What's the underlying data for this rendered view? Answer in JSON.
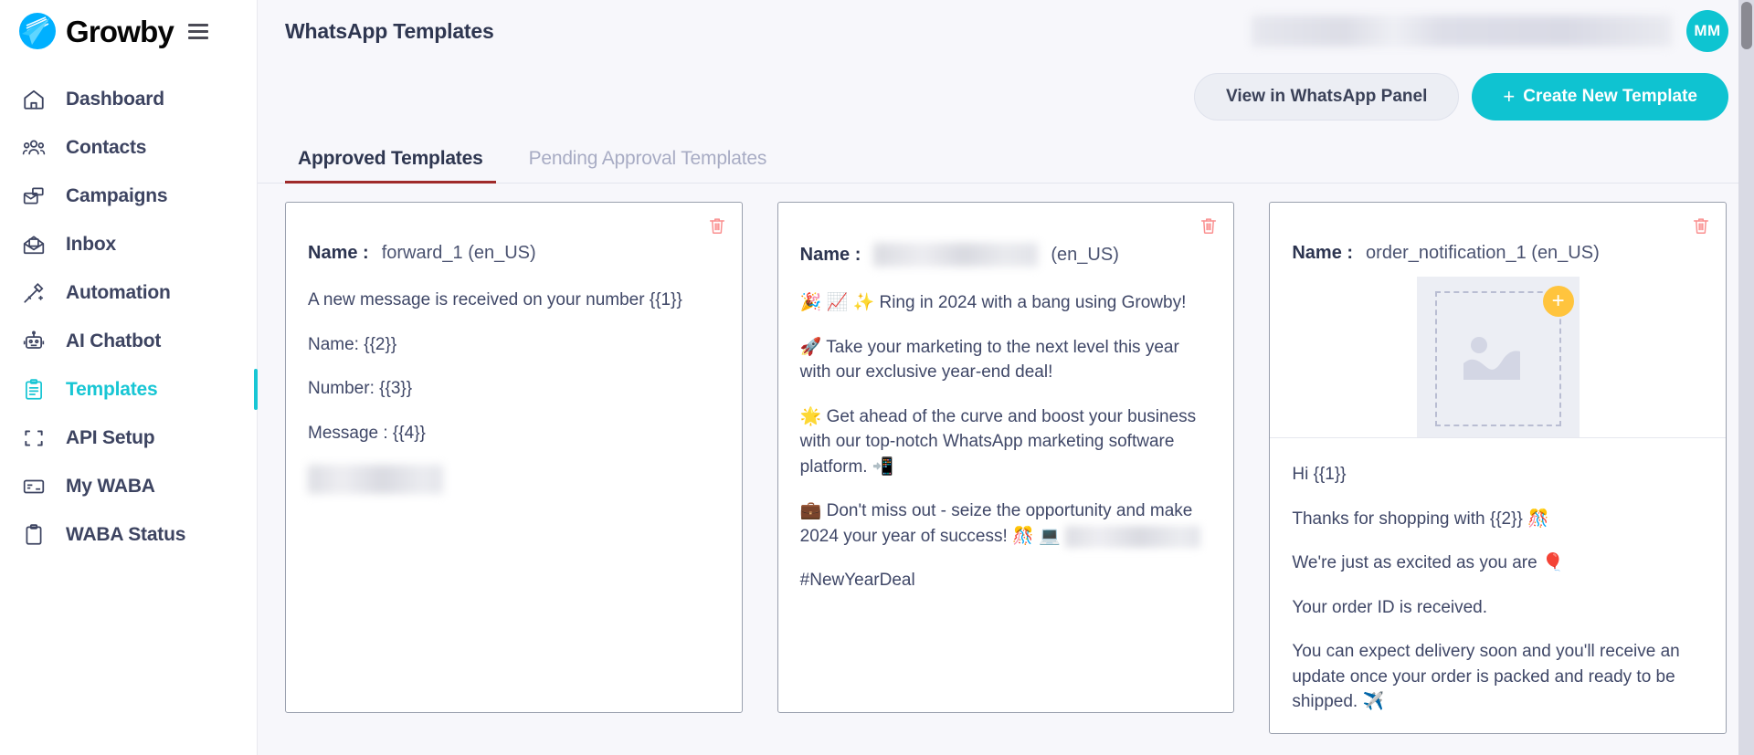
{
  "brand": {
    "name": "Growby",
    "accent_teal": "#0fc3d1",
    "logo_blue": "#00b0ff"
  },
  "sidebar": {
    "menu_icon": "hamburger-icon",
    "items": [
      {
        "label": "Dashboard",
        "icon": "home-icon",
        "active": false
      },
      {
        "label": "Contacts",
        "icon": "people-icon",
        "active": false
      },
      {
        "label": "Campaigns",
        "icon": "megaphone-icon",
        "active": false
      },
      {
        "label": "Inbox",
        "icon": "inbox-icon",
        "active": false
      },
      {
        "label": "Automation",
        "icon": "magic-wand-icon",
        "active": false
      },
      {
        "label": "AI Chatbot",
        "icon": "robot-icon",
        "active": false
      },
      {
        "label": "Templates",
        "icon": "clipboard-icon",
        "active": true
      },
      {
        "label": "API Setup",
        "icon": "brackets-icon",
        "active": false
      },
      {
        "label": "My WABA",
        "icon": "card-icon",
        "active": false
      },
      {
        "label": "WABA Status",
        "icon": "clipboard-status-icon",
        "active": false
      }
    ]
  },
  "header": {
    "title": "WhatsApp Templates",
    "account_info_redacted": true,
    "avatar_initials": "MM"
  },
  "actions": {
    "view_panel_label": "View in WhatsApp Panel",
    "create_template_label": "Create New Template",
    "create_template_plus": "+"
  },
  "tabs": [
    {
      "label": "Approved Templates",
      "active": true
    },
    {
      "label": "Pending Approval Templates",
      "active": false
    }
  ],
  "cards": [
    {
      "name_label": "Name :",
      "name_value": "forward_1 (en_US)",
      "name_redacted": false,
      "delete_icon": "trash-icon",
      "has_media": false,
      "body": [
        "A new message is received on your number {{1}}",
        "Name: {{2}}",
        "Number: {{3}}",
        "Message : {{4}}"
      ],
      "trailing_redacted_block": true
    },
    {
      "name_label": "Name :",
      "name_value_redacted": true,
      "name_suffix": "(en_US)",
      "name_redacted": true,
      "delete_icon": "trash-icon",
      "has_media": false,
      "body": [
        "🎉 📈 ✨ Ring in 2024 with a bang using Growby!",
        "🚀 Take your marketing to the next level this year with our exclusive year-end deal!",
        "🌟 Get ahead of the curve and boost your business with our top-notch WhatsApp marketing software platform. 📲",
        "💼 Don't miss out - seize the opportunity and make 2024 your year of success! 🎊 💻",
        "#NewYearDeal"
      ],
      "inline_redacted_after_index": 3,
      "trailing_redacted_block": false
    },
    {
      "name_label": "Name :",
      "name_value": "order_notification_1 (en_US)",
      "name_redacted": false,
      "delete_icon": "trash-icon",
      "has_media": true,
      "media_placeholder_icon": "image-placeholder-icon",
      "media_badge_icon": "plus-badge-icon",
      "body": [
        "Hi {{1}}",
        "Thanks for shopping with {{2}} 🎊",
        "We're just as excited as you are 🎈",
        "Your order ID is received.",
        "You can expect delivery soon and you'll receive an update once your order is packed and ready to be shipped. ✈️"
      ],
      "trailing_redacted_block": false
    }
  ],
  "scrollbar": {
    "orientation": "vertical",
    "position": "top"
  }
}
